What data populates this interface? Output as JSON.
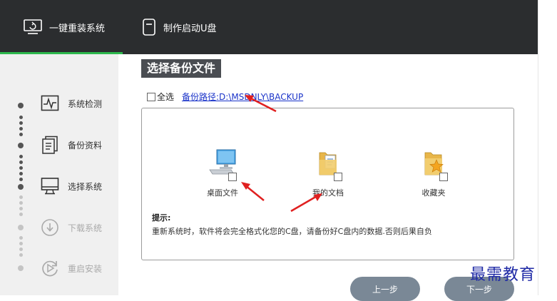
{
  "header": {
    "tabs": [
      {
        "label": "一键重装系统",
        "icon": "monitor-icon",
        "active": true
      },
      {
        "label": "制作启动U盘",
        "icon": "usb-drive-icon",
        "active": false
      }
    ],
    "active_color": "#2db84d"
  },
  "sidebar": {
    "steps": [
      {
        "label": "系统检测",
        "icon": "pulse-monitor-icon",
        "enabled": true
      },
      {
        "label": "备份资料",
        "icon": "documents-icon",
        "enabled": true
      },
      {
        "label": "选择系统",
        "icon": "desktop-monitor-icon",
        "enabled": true
      },
      {
        "label": "下载系统",
        "icon": "download-icon",
        "enabled": false
      },
      {
        "label": "重启安装",
        "icon": "restart-icon",
        "enabled": false
      }
    ]
  },
  "main": {
    "title": "选择备份文件",
    "select_all_label": "全选",
    "backup_path": "备份路径:D:\\MSDNLY\\BACKUP",
    "items": [
      {
        "label": "桌面文件",
        "icon": "desktop-computer-icon",
        "checked": false
      },
      {
        "label": "我的文档",
        "icon": "documents-folder-icon",
        "checked": false
      },
      {
        "label": "收藏夹",
        "icon": "favorites-folder-icon",
        "checked": false
      }
    ],
    "hint_title": "提示:",
    "hint_text": "重新系统时，软件将会完全格式化您的C盘，请备份好C盘内的数据.否则后果自负"
  },
  "footer": {
    "prev_label": "上一步",
    "next_label": "下一步"
  },
  "watermark": "最需教育",
  "colors": {
    "header_bg": "#2b2d2f",
    "button_bg": "#7a8896",
    "annotation_arrow": "#e02020",
    "link": "#1a33c9"
  }
}
